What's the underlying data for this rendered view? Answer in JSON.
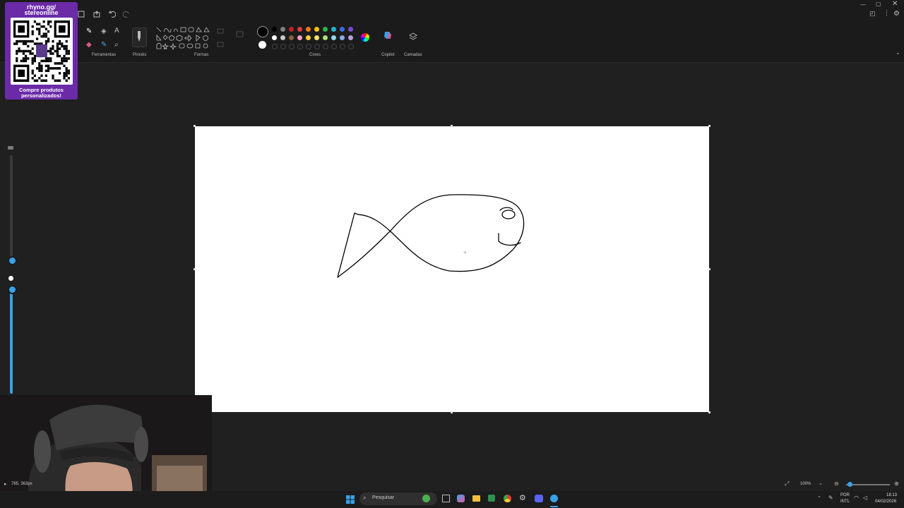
{
  "overlay": {
    "line1": "rhyno.gg/",
    "line2": "stereonline",
    "cta1": "Compre produtos",
    "cta2": "personalizados!"
  },
  "ribbon": {
    "ferramentas": "Ferramentas",
    "pinceis": "Pincéis",
    "formas": "Formas",
    "cores": "Cores",
    "copilot": "Copilot",
    "camadas": "Camadas"
  },
  "colors": {
    "row1": [
      "#000000",
      "#808080",
      "#c4202a",
      "#e03a3a",
      "#f07a1a",
      "#f5c518",
      "#2fb34a",
      "#22b5c9",
      "#3c6ae0",
      "#7a4bd0"
    ],
    "row2": [
      "#ffffff",
      "#c8c8c8",
      "#8b5a3c",
      "#f0a0c0",
      "#f5d040",
      "#f0e070",
      "#a8e07a",
      "#8fd8f0",
      "#8aa8e8",
      "#b8a0e0"
    ]
  },
  "status": {
    "cursor_pos": "765, 363px",
    "zoom": "100%"
  },
  "taskbar": {
    "search_placeholder": "Pesquisar",
    "lang1": "POR",
    "lang2": "INTL",
    "time": "18:13",
    "date": "04/02/2026"
  }
}
